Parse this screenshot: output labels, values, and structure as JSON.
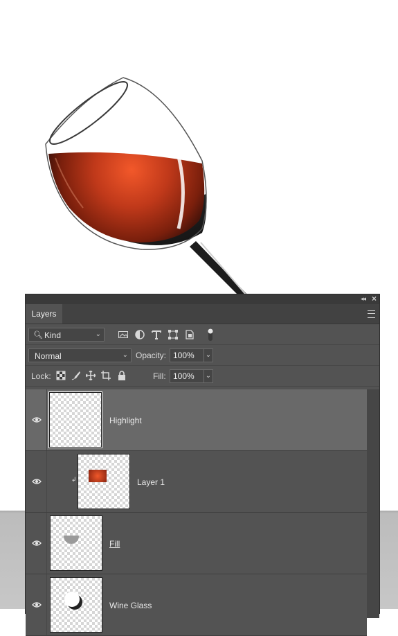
{
  "panel": {
    "tab_label": "Layers",
    "filter": {
      "kind_label": "Kind",
      "icons": [
        "pixel-filter-icon",
        "adjustment-filter-icon",
        "type-filter-icon",
        "shape-filter-icon",
        "smart-object-filter-icon",
        "filter-toggle-icon"
      ]
    },
    "blend_mode": "Normal",
    "opacity_label": "Opacity:",
    "opacity_value": "100%",
    "lock_label": "Lock:",
    "lock_icons": [
      "lock-transparent-pixels-icon",
      "lock-image-pixels-icon",
      "lock-position-icon",
      "lock-artboard-icon",
      "lock-all-icon"
    ],
    "fill_label": "Fill:",
    "fill_value": "100%"
  },
  "layers": [
    {
      "name": "Highlight",
      "selected": true,
      "visible": true
    },
    {
      "name": "Layer 1",
      "selected": false,
      "visible": true,
      "clipped": true
    },
    {
      "name": "Fill",
      "selected": false,
      "visible": true
    },
    {
      "name": "Wine Glass",
      "selected": false,
      "visible": true
    }
  ],
  "colors": {
    "panel_bg": "#535353",
    "selected_row": "#696969",
    "wine": "#c8401c"
  }
}
